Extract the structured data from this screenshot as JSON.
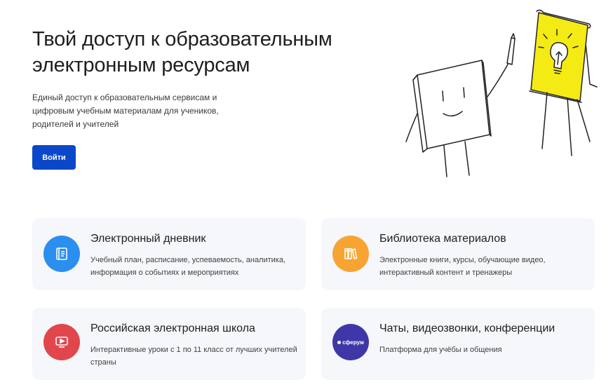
{
  "hero": {
    "title": "Твой доступ к образовательным электронным ресурсам",
    "subtitle": "Единый доступ к образовательным сервисам и цифровым учебным материалам для учеников, родителей и учителей",
    "login_label": "Войти"
  },
  "cards": [
    {
      "title": "Электронный дневник",
      "description": "Учебный план, расписание, успеваемость, аналитика, информация о событиях и мероприятиях",
      "icon": "diary-icon",
      "color": "#2c8ff0"
    },
    {
      "title": "Библиотека материалов",
      "description": "Электронные книги, курсы, обучающие видео, интерактивный контент и тренажеры",
      "icon": "books-icon",
      "color": "#f7a432"
    },
    {
      "title": "Российская электронная школа",
      "description": "Интерактивные уроки с 1 по 11 класс от лучших учителей страны",
      "icon": "video-play-icon",
      "color": "#e2464d"
    },
    {
      "title": "Чаты, видеозвонки, конференции",
      "description": "Платформа для учёбы и общения",
      "icon": "sferum-logo",
      "logo_text": "сферум",
      "color": "#3f37a8"
    }
  ],
  "colors": {
    "primary": "#0b47c9",
    "card_bg": "#f5f7fb",
    "illustration_yellow": "#f5eb14"
  }
}
